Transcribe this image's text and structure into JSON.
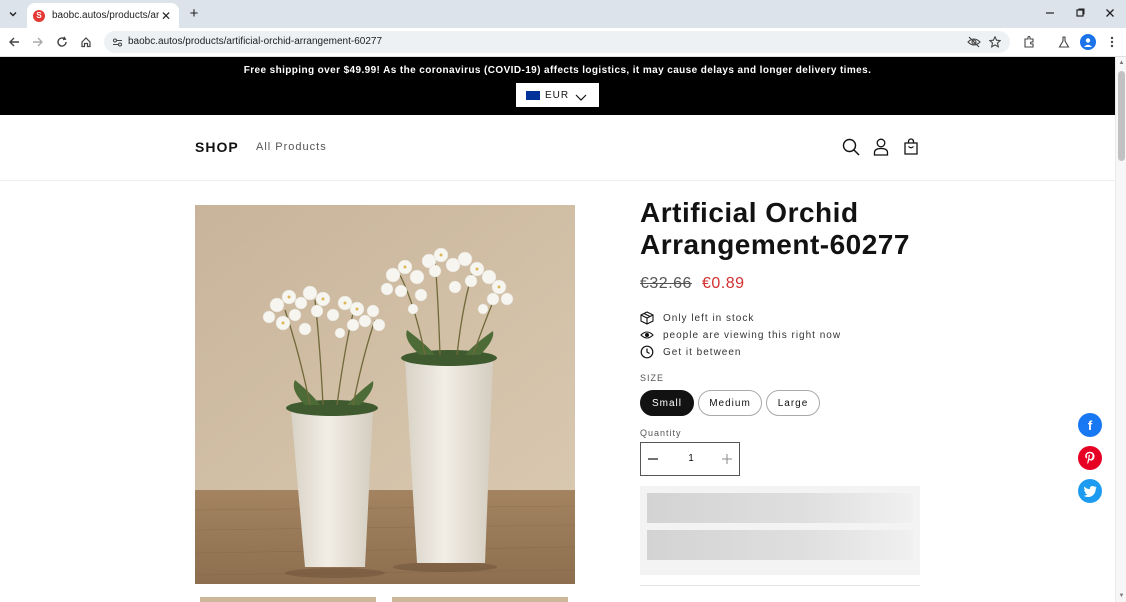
{
  "browser": {
    "tab_title": "baobc.autos/products/artificia",
    "url": "baobc.autos/products/artificial-orchid-arrangement-60277",
    "new_tab": "+",
    "close_tab": "✕"
  },
  "announcement": {
    "text": "Free shipping over $49.99! As the coronavirus (COVID-19) affects logistics, it may cause delays and longer delivery times.",
    "currency": "EUR"
  },
  "header": {
    "logo": "SHOP",
    "nav_all_products": "All Products",
    "icons": [
      "search-icon",
      "account-icon",
      "cart-icon"
    ]
  },
  "product": {
    "title": "Artificial Orchid Arrangement-60277",
    "price_compare": "€32.66",
    "price_sale": "€0.89",
    "info": {
      "stock": "Only left in stock",
      "viewers": "people are viewing this right now",
      "delivery": "Get it between"
    },
    "size_label": "SIZE",
    "sizes": [
      "Small",
      "Medium",
      "Large"
    ],
    "selected_size": "Small",
    "quantity_label": "Quantity",
    "quantity": "1"
  },
  "colors": {
    "sale_price": "#d32f2f",
    "facebook": "#1877f2",
    "pinterest": "#e60023",
    "twitter": "#1d9bf0"
  }
}
